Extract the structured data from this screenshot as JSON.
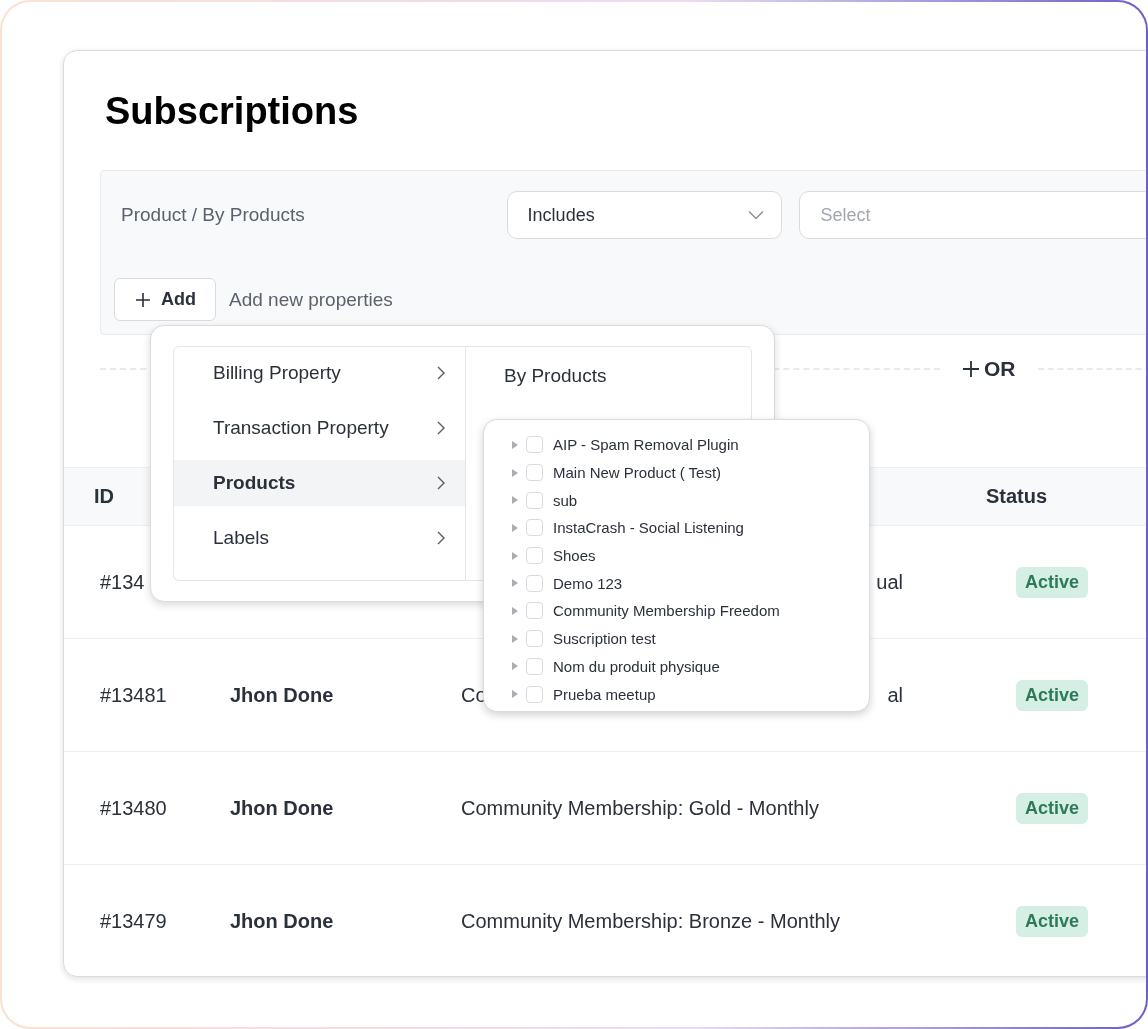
{
  "title": "Subscriptions",
  "filter": {
    "property": "Product / By Products",
    "operator": "Includes",
    "value_placeholder": "Select",
    "add_button": "Add",
    "add_hint": "Add new properties"
  },
  "or_button": "OR",
  "table": {
    "header": {
      "id": "ID",
      "status": "Status"
    },
    "rows": [
      {
        "id": "#134",
        "plan_end": "ual",
        "status": "Active"
      },
      {
        "id": "#13481",
        "name": "Jhon Done",
        "plan_start": "Co",
        "plan_end": "al",
        "status": "Active"
      },
      {
        "id": "#13480",
        "name": "Jhon Done",
        "plan": "Community Membership: Gold - Monthly",
        "status": "Active"
      },
      {
        "id": "#13479",
        "name": "Jhon Done",
        "plan": "Community Membership: Bronze - Monthly",
        "status": "Active"
      }
    ]
  },
  "menu": {
    "categories": [
      {
        "label": "Billing Property",
        "selected": false
      },
      {
        "label": "Transaction Property",
        "selected": false
      },
      {
        "label": "Products",
        "selected": true
      },
      {
        "label": "Labels",
        "selected": false
      }
    ],
    "submenu_title": "By Products",
    "products": [
      {
        "label": "AIP - Spam Removal Plugin",
        "checked": false,
        "expanded": false
      },
      {
        "label": "Main New Product ( Test)",
        "checked": false,
        "expanded": false
      },
      {
        "label": "sub",
        "checked": false,
        "expanded": false
      },
      {
        "label": "InstaCrash - Social Listening",
        "checked": false,
        "expanded": false
      },
      {
        "label": "Shoes",
        "checked": false,
        "expanded": false
      },
      {
        "label": "Demo 123",
        "checked": false,
        "expanded": false
      },
      {
        "label": "Community Membership Freedom",
        "checked": false,
        "expanded": false
      },
      {
        "label": "Suscription test",
        "checked": false,
        "expanded": false
      },
      {
        "label": "Nom du produit physique",
        "checked": false,
        "expanded": false
      },
      {
        "label": "Prueba meetup",
        "checked": false,
        "expanded": false
      }
    ]
  }
}
